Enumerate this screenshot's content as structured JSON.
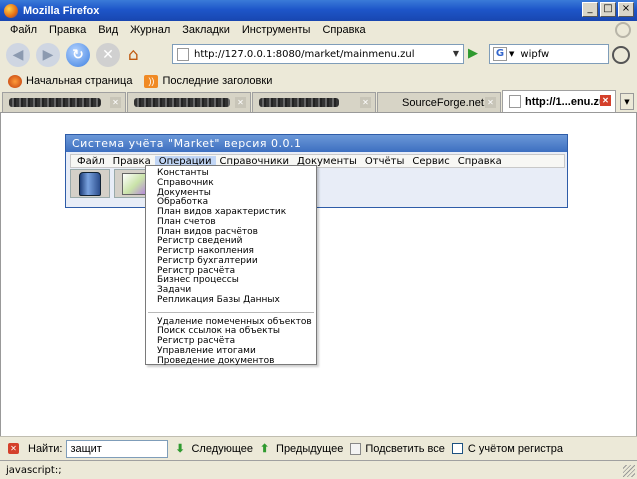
{
  "window": {
    "title": "Mozilla Firefox",
    "controls": [
      "_",
      "□",
      "×"
    ]
  },
  "menubar": [
    "Файл",
    "Правка",
    "Вид",
    "Журнал",
    "Закладки",
    "Инструменты",
    "Справка"
  ],
  "navbar": {
    "url": "http://127.0.0.1:8080/market/mainmenu.zul",
    "search_engine_letter": "G",
    "search_value": "wipfw"
  },
  "bookmarks": [
    {
      "label": "Начальная страница",
      "icon": "firefox-icon"
    },
    {
      "label": "Последние заголовки",
      "icon": "rss-icon"
    }
  ],
  "tabs": [
    {
      "label": "",
      "obscured": true
    },
    {
      "label": "",
      "obscured": true
    },
    {
      "label": "",
      "obscured": true
    },
    {
      "label": "SourceForge.net...",
      "obscured": false
    },
    {
      "label": "http://1...enu.zul",
      "obscured": false,
      "active": true
    }
  ],
  "app": {
    "caption": "Система учёта \"Market\" версия 0.0.1",
    "menu": [
      "Файл",
      "Правка",
      "Операции",
      "Справочники",
      "Документы",
      "Отчёты",
      "Сервис",
      "Справка"
    ],
    "active_menu_index": 2,
    "toolbar_icons": [
      "bin-icon",
      "files-icon"
    ],
    "dropdown_group1": [
      "Константы",
      "Справочник",
      "Документы",
      "Обработка",
      "План видов характеристик",
      "План счетов",
      "План видов расчётов",
      "Регистр сведений",
      "Регистр накопления",
      "Регистр бухгалтерии",
      "Регистр расчёта",
      "Бизнес процессы",
      "Задачи",
      "Репликация Базы Данных"
    ],
    "dropdown_group2": [
      "Удаление помеченных объектов",
      "Поиск ссылок на объекты",
      "Регистр расчёта",
      "Управление итогами",
      "Проведение документов"
    ]
  },
  "findbar": {
    "label": "Найти:",
    "value": "защит",
    "next": "Следующее",
    "prev": "Предыдущее",
    "highlight": "Подсветить все",
    "match_case": "С учётом регистра"
  },
  "status": "javascript:;"
}
